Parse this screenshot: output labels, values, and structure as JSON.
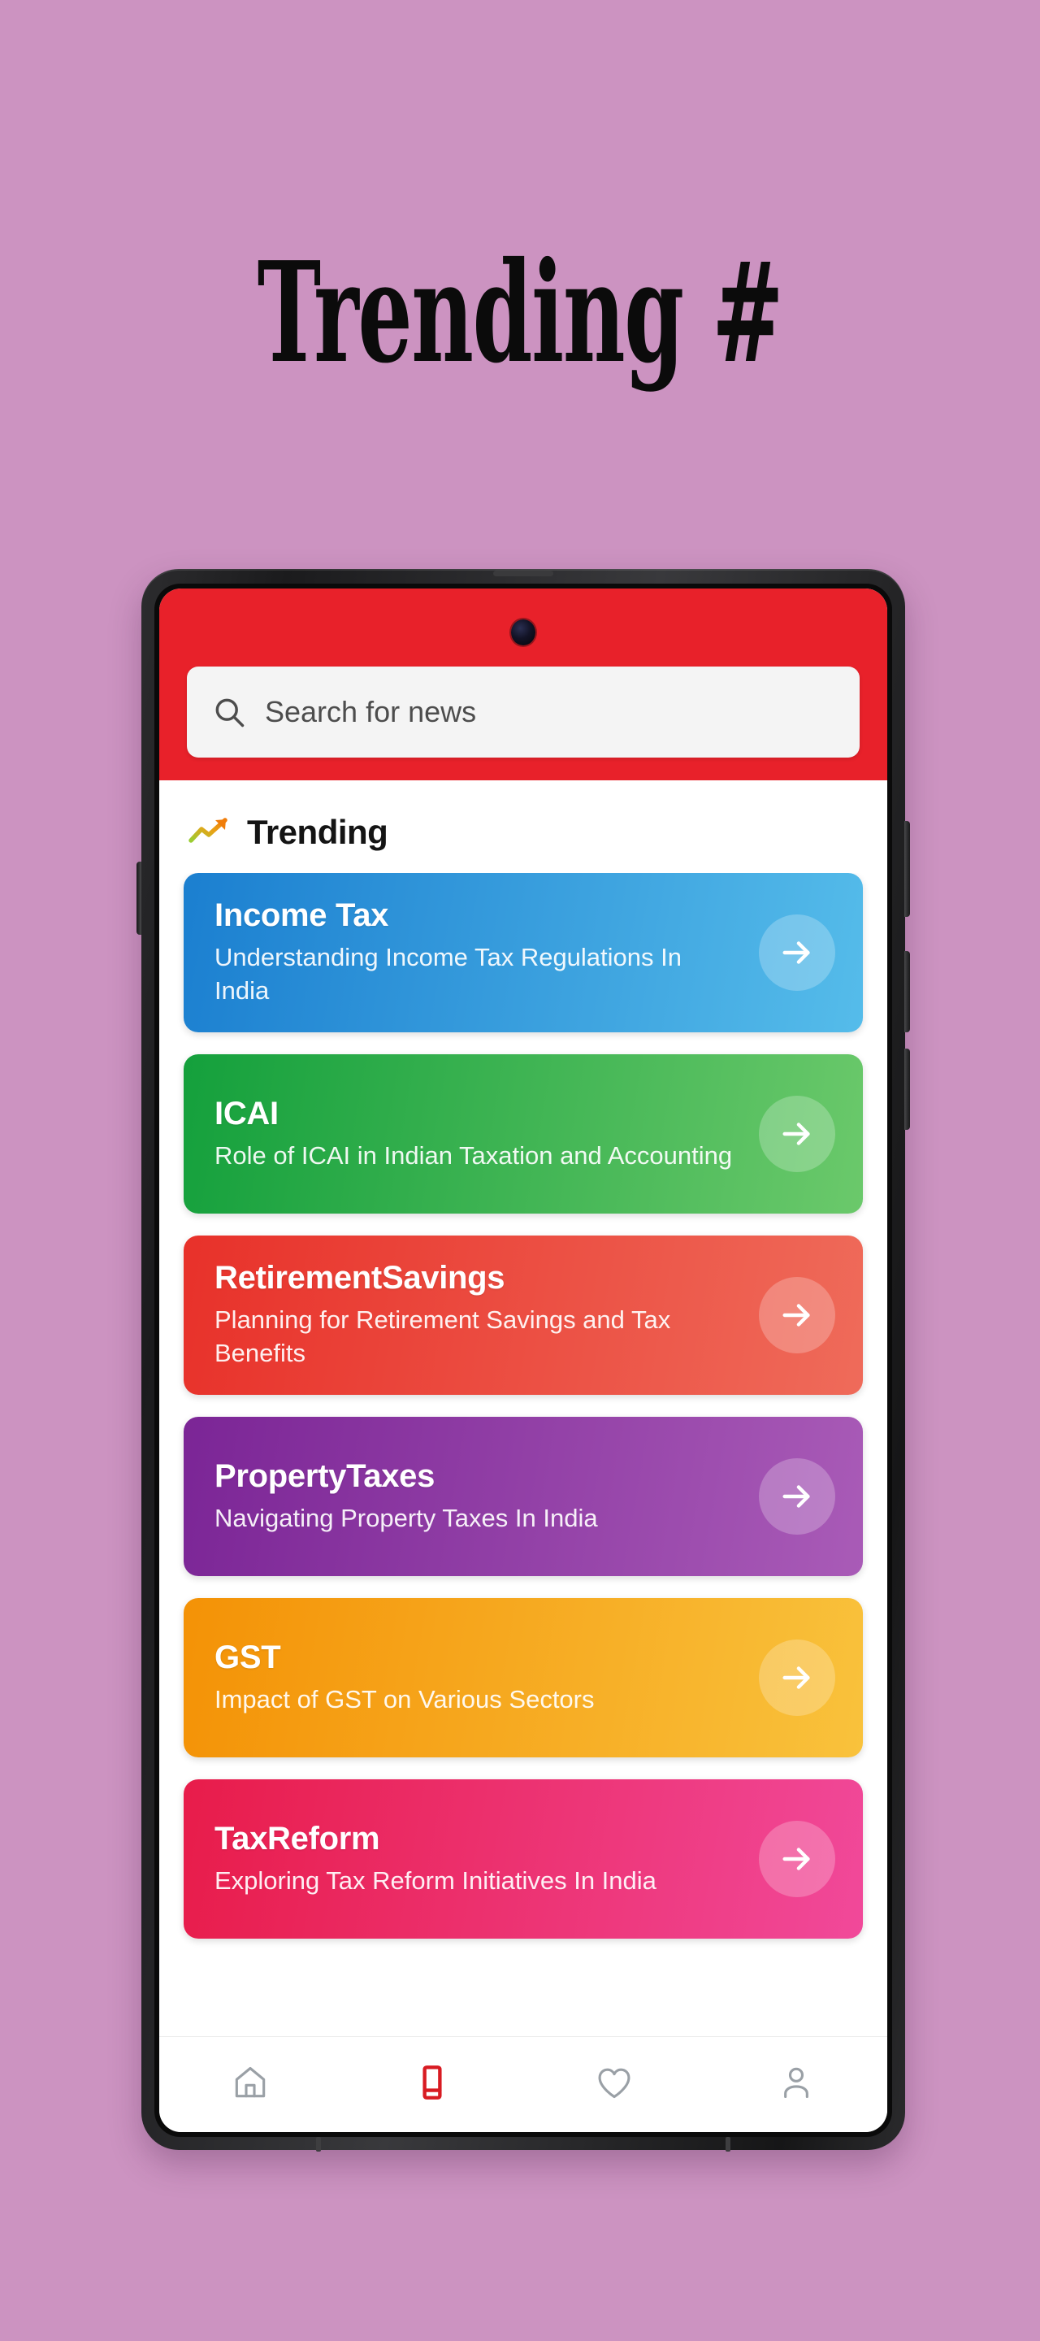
{
  "poster": {
    "headline": "Trending #",
    "background_color": "#CC93C1",
    "headline_color": "#0B0B0B"
  },
  "app": {
    "header": {
      "background_color": "#E8212A",
      "camera_icon": "front-camera-punch-hole"
    },
    "search": {
      "placeholder": "Search for news",
      "value": "",
      "icon": "search-icon",
      "background_color": "#F4F4F4"
    },
    "section": {
      "title": "Trending",
      "icon": "trending-up-icon"
    },
    "cards": [
      {
        "title": "Income Tax",
        "subtitle": "Understanding Income Tax Regulations In India",
        "gradient_from": "#1B7FD0",
        "gradient_to": "#55BCEA",
        "arrow_icon": "arrow-right-icon"
      },
      {
        "title": "ICAI",
        "subtitle": "Role of ICAI in Indian Taxation and Accounting",
        "gradient_from": "#14A03C",
        "gradient_to": "#6BC96B",
        "arrow_icon": "arrow-right-icon"
      },
      {
        "title": "RetirementSavings",
        "subtitle": "Planning for Retirement Savings and Tax Benefits",
        "gradient_from": "#E8312A",
        "gradient_to": "#EF6B5A",
        "arrow_icon": "arrow-right-icon"
      },
      {
        "title": "PropertyTaxes",
        "subtitle": "Navigating Property Taxes In India",
        "gradient_from": "#7B2596",
        "gradient_to": "#A95BB7",
        "arrow_icon": "arrow-right-icon"
      },
      {
        "title": "GST",
        "subtitle": "Impact of GST on Various Sectors",
        "gradient_from": "#F49206",
        "gradient_to": "#F9C23C",
        "arrow_icon": "arrow-right-icon"
      },
      {
        "title": "TaxReform",
        "subtitle": "Exploring Tax Reform Initiatives In India",
        "gradient_from": "#E81C4A",
        "gradient_to": "#F1499A",
        "arrow_icon": "arrow-right-icon"
      }
    ],
    "bottom_nav": [
      {
        "icon": "home-icon",
        "label": "Home",
        "active": false,
        "color": "#9aa0a6"
      },
      {
        "icon": "news-icon",
        "label": "News",
        "active": true,
        "color": "#D81B22"
      },
      {
        "icon": "heart-icon",
        "label": "Favorites",
        "active": false,
        "color": "#9aa0a6"
      },
      {
        "icon": "person-icon",
        "label": "Profile",
        "active": false,
        "color": "#9aa0a6"
      }
    ]
  }
}
